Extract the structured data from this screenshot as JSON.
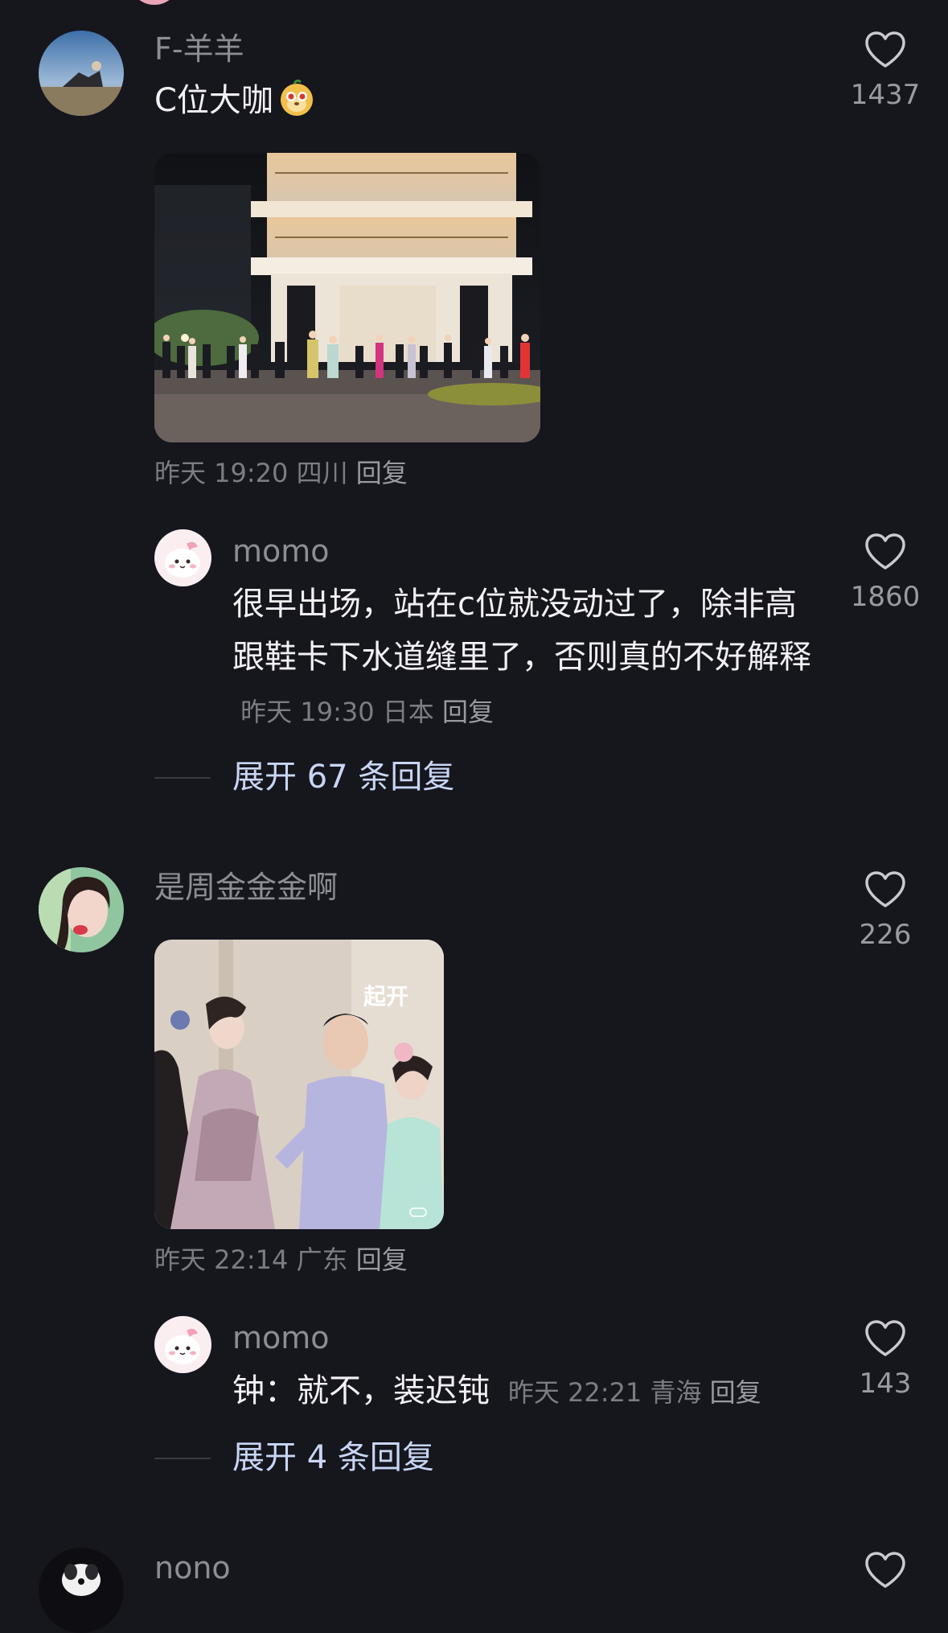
{
  "comments": [
    {
      "username": "F-羊羊",
      "text": "C位大咖",
      "emoji": "mole-face-emoji",
      "meta": {
        "time": "昨天 19:20",
        "location": "四川",
        "reply": "回复"
      },
      "likes": "1437",
      "replies": [
        {
          "username": "momo",
          "text": "很早出场，站在c位就没动过了，除非高跟鞋卡下水道缝里了，否则真的不好解释",
          "meta": {
            "time": "昨天 19:30",
            "location": "日本",
            "reply": "回复"
          },
          "likes": "1860"
        }
      ],
      "expand": "展开 67 条回复"
    },
    {
      "username": "是周金金金啊",
      "text": "",
      "image_caption": "起开",
      "meta": {
        "time": "昨天 22:14",
        "location": "广东",
        "reply": "回复"
      },
      "likes": "226",
      "replies": [
        {
          "username": "momo",
          "text": "钟：就不，装迟钝",
          "meta": {
            "time": "昨天 22:21",
            "location": "青海",
            "reply": "回复"
          },
          "likes": "143"
        }
      ],
      "expand": "展开 4 条回复"
    },
    {
      "username": "nono"
    }
  ],
  "icons": {
    "like": "heart-outline-icon"
  },
  "colors": {
    "background": "#16161d",
    "expand_link": "#c8d6f5"
  }
}
